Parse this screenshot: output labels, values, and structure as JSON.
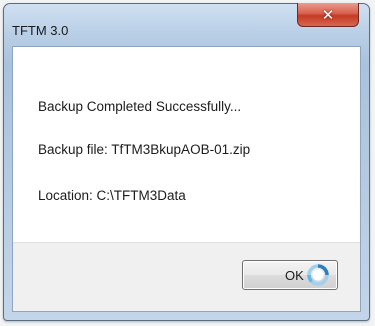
{
  "window": {
    "title": "TFTM 3.0",
    "close_glyph": "✕"
  },
  "message": {
    "line1": "Backup Completed Successfully...",
    "line2": "Backup file: TfTM3BkupAOB-01.zip",
    "line3": "Location: C:\\TFTM3Data"
  },
  "buttons": {
    "ok_label": "OK"
  },
  "icons": {
    "close": "close-icon",
    "busy": "busy-spinner-icon"
  },
  "colors": {
    "close_button": "#c53a24",
    "spinner": "#4aa3df"
  }
}
